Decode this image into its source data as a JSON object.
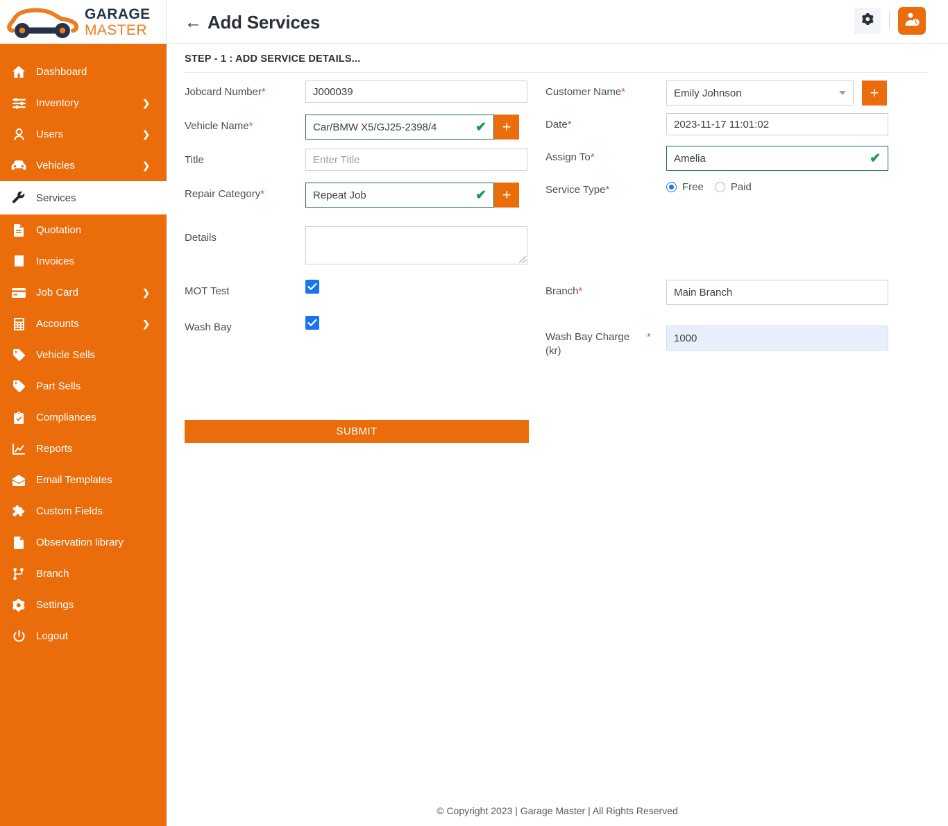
{
  "brand": {
    "name_line1": "GARAGE",
    "name_line2": "MASTER",
    "logo_icon": "car-wrench-logo",
    "primary_color": "#ea6c0a",
    "dark_color": "#263247"
  },
  "sidebar": {
    "items": [
      {
        "label": "Dashboard",
        "icon": "home-icon",
        "has_chevron": false,
        "active": false
      },
      {
        "label": "Inventory",
        "icon": "sliders-icon",
        "has_chevron": true,
        "active": false
      },
      {
        "label": "Users",
        "icon": "user-icon",
        "has_chevron": true,
        "active": false
      },
      {
        "label": "Vehicles",
        "icon": "car-icon",
        "has_chevron": true,
        "active": false
      },
      {
        "label": "Services",
        "icon": "wrench-icon",
        "has_chevron": false,
        "active": true
      },
      {
        "label": "Quotation",
        "icon": "file-invoice-icon",
        "has_chevron": false,
        "active": false
      },
      {
        "label": "Invoices",
        "icon": "receipt-icon",
        "has_chevron": false,
        "active": false
      },
      {
        "label": "Job Card",
        "icon": "card-icon",
        "has_chevron": true,
        "active": false
      },
      {
        "label": "Accounts",
        "icon": "calculator-icon",
        "has_chevron": true,
        "active": false
      },
      {
        "label": "Vehicle Sells",
        "icon": "tag-icon",
        "has_chevron": false,
        "active": false
      },
      {
        "label": "Part Sells",
        "icon": "tag-icon",
        "has_chevron": false,
        "active": false
      },
      {
        "label": "Compliances",
        "icon": "clipboard-check-icon",
        "has_chevron": false,
        "active": false
      },
      {
        "label": "Reports",
        "icon": "chart-line-icon",
        "has_chevron": false,
        "active": false
      },
      {
        "label": "Email Templates",
        "icon": "mail-open-icon",
        "has_chevron": false,
        "active": false
      },
      {
        "label": "Custom Fields",
        "icon": "puzzle-icon",
        "has_chevron": false,
        "active": false
      },
      {
        "label": "Observation library",
        "icon": "document-icon",
        "has_chevron": false,
        "active": false
      },
      {
        "label": "Branch",
        "icon": "sitemap-icon",
        "has_chevron": false,
        "active": false
      },
      {
        "label": "Settings",
        "icon": "gear-icon",
        "has_chevron": false,
        "active": false
      },
      {
        "label": "Logout",
        "icon": "power-icon",
        "has_chevron": false,
        "active": false
      }
    ]
  },
  "header": {
    "back_arrow": "←",
    "title": "Add Services",
    "settings_icon": "gear-icon",
    "user_icon": "user-clock-icon"
  },
  "main": {
    "step_title": "STEP - 1 : ADD SERVICE DETAILS...",
    "fields": {
      "jobcard_number": {
        "label": "Jobcard Number",
        "required": true,
        "value": "J000039"
      },
      "vehicle_name": {
        "label": "Vehicle Name",
        "required": true,
        "value": "Car/BMW X5/GJ25-2398/4",
        "valid": true,
        "add_label": "+"
      },
      "title": {
        "label": "Title",
        "required": false,
        "value": "",
        "placeholder": "Enter Title"
      },
      "repair_category": {
        "label": "Repair Category",
        "required": true,
        "value": "Repeat Job",
        "valid": true,
        "add_label": "+"
      },
      "details": {
        "label": "Details",
        "required": false,
        "value": ""
      },
      "mot_test": {
        "label": "MOT Test",
        "checked": true
      },
      "wash_bay": {
        "label": "Wash Bay",
        "checked": true
      },
      "customer_name": {
        "label": "Customer Name",
        "required": true,
        "value": "Emily Johnson",
        "add_label": "+"
      },
      "date": {
        "label": "Date",
        "required": true,
        "value": "2023-11-17  11:01:02"
      },
      "assign_to": {
        "label": "Assign To",
        "required": true,
        "value": "Amelia",
        "valid": true
      },
      "service_type": {
        "label": "Service Type",
        "required": true,
        "options": [
          "Free",
          "Paid"
        ],
        "selected": "Free"
      },
      "branch": {
        "label": "Branch",
        "required": true,
        "value": "Main Branch"
      },
      "wash_bay_charge": {
        "label": "Wash Bay Charge\n(kr)",
        "required": true,
        "value": "1000"
      }
    },
    "submit_label": "SUBMIT"
  },
  "footer": {
    "text": "© Copyright 2023 | Garage Master | All Rights Reserved"
  }
}
